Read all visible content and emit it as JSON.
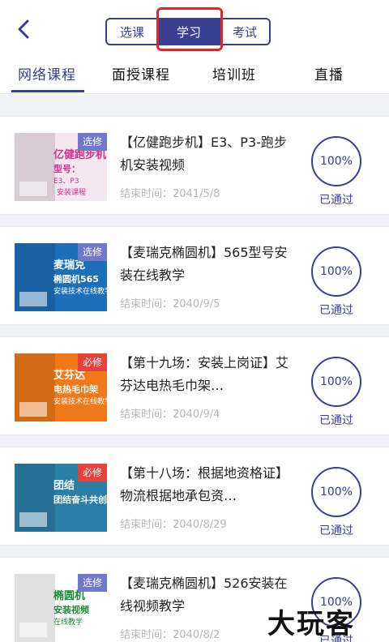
{
  "header": {
    "segments": [
      "选课",
      "学习",
      "考试"
    ]
  },
  "tabs": [
    "网络课程",
    "面授课程",
    "培训班",
    "直播"
  ],
  "courses": [
    {
      "badge": "选修",
      "badge_type": "elective",
      "title": "【亿健跑步机】E3、P3-跑步机安装视频",
      "end_time": "结束时间：2041/5/8",
      "progress": "100%",
      "status": "已通过",
      "thumb": {
        "brand": "亿健跑步机",
        "line1": "型号：",
        "line2": "E3、P3",
        "line3": "安装课程",
        "bg": "#f4e8f0",
        "accent": "#d8308a"
      }
    },
    {
      "badge": "选修",
      "badge_type": "elective",
      "title": "【麦瑞克椭圆机】565型号安装在线教学",
      "end_time": "结束时间：2040/9/5",
      "progress": "100%",
      "status": "已通过",
      "thumb": {
        "brand": "麦瑞克",
        "line1": "椭圆机565",
        "line2": "安装技术在线教学",
        "bg": "#1d6fb8",
        "accent": "#ffffff"
      }
    },
    {
      "badge": "必修",
      "badge_type": "required",
      "title": "【第十九场：安装上岗证】艾芬达电热毛巾架…",
      "end_time": "结束时间：2040/9/4",
      "progress": "100%",
      "status": "已通过",
      "thumb": {
        "brand": "艾芬达",
        "line1": "电热毛巾架",
        "line2": "安装技术在线教学",
        "bg": "#f07a1a",
        "accent": "#ffffff"
      }
    },
    {
      "badge": "必修",
      "badge_type": "required",
      "title": "【第十八场：根据地资格证】物流根据地承包资…",
      "end_time": "结束时间：2040/8/29",
      "progress": "100%",
      "status": "已通过",
      "thumb": {
        "brand": "团结",
        "line1": "团结奋斗共创",
        "line2": "",
        "bg": "#2a7fa8",
        "accent": "#ffffff"
      }
    },
    {
      "badge": "选修",
      "badge_type": "elective",
      "title": "【麦瑞克椭圆机】526安装在线视频教学",
      "end_time": "结束时间：2040/8/2",
      "progress": "100%",
      "status": "已通过",
      "thumb": {
        "brand": "椭圆机",
        "line1": "安装视频",
        "line2": "在线教学",
        "bg": "#ffffff",
        "accent": "#1f8a3a"
      }
    }
  ],
  "watermark": "大玩客",
  "colors": {
    "primary": "#3a3f92",
    "required_badge": "#e8413b",
    "elective_badge": "#6f78c9",
    "highlight": "#e0262a"
  }
}
